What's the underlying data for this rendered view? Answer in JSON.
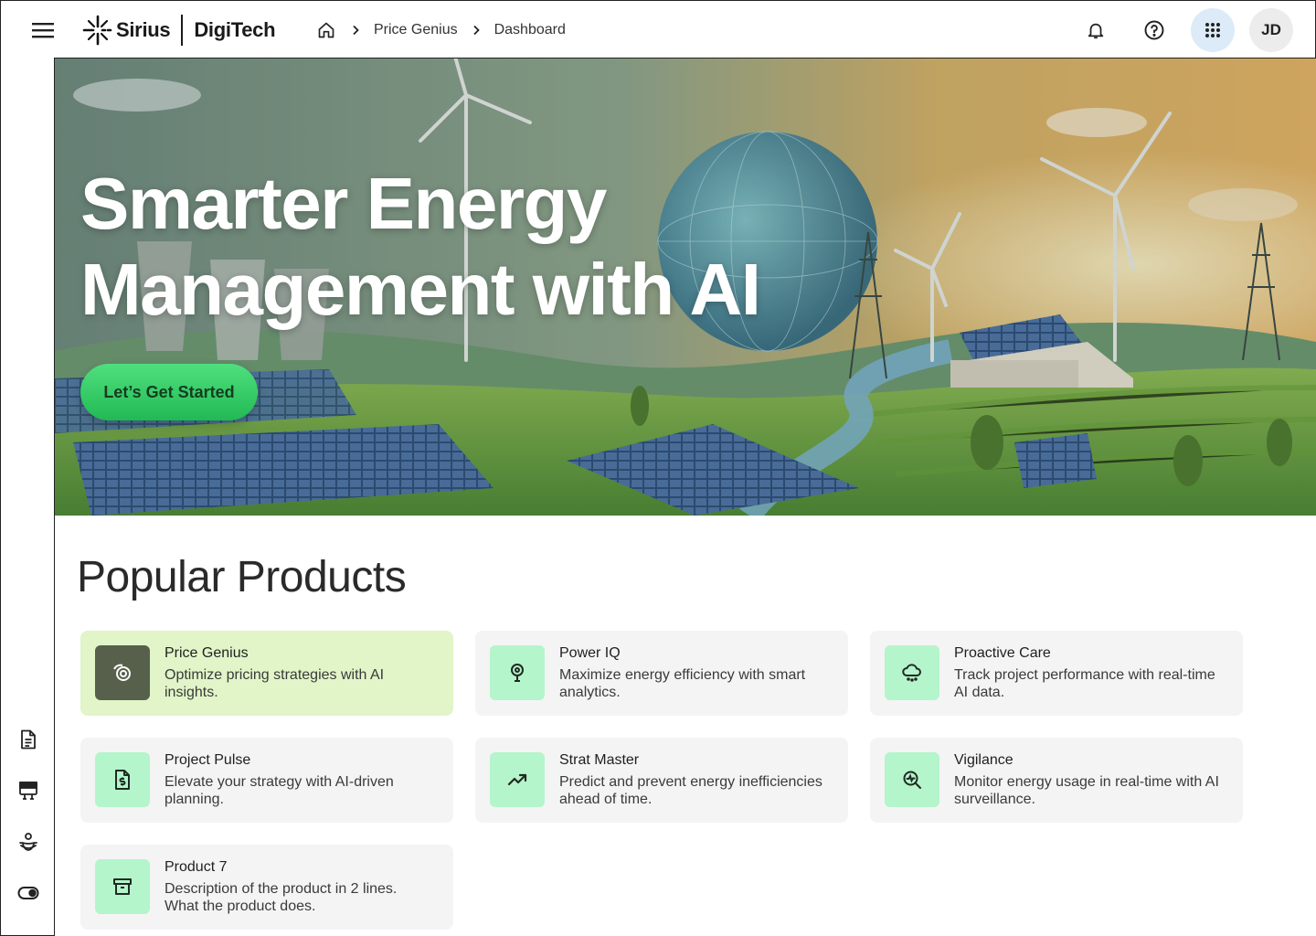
{
  "header": {
    "menu_icon": "hamburger-menu-icon",
    "logo": {
      "left": "Sirius",
      "right": "DigiTech"
    },
    "breadcrumb": {
      "home_icon": "home-icon",
      "items": [
        "Price Genius",
        "Dashboard"
      ]
    },
    "actions": {
      "notifications_icon": "bell-icon",
      "help_icon": "help-circle-icon",
      "apps_icon": "grid-apps-icon"
    },
    "user_initials": "JD"
  },
  "sidebar": {
    "items": [
      {
        "icon": "document-icon"
      },
      {
        "icon": "billboard-icon"
      },
      {
        "icon": "hand-coin-icon"
      },
      {
        "icon": "toggle-icon"
      }
    ]
  },
  "hero": {
    "title": "Smarter Energy Management with AI",
    "cta_label": "Let’s Get Started"
  },
  "products": {
    "title": "Popular Products",
    "items": [
      {
        "title": "Price Genius",
        "description": "Optimize pricing strategies with AI insights.",
        "icon": "target-swirl-icon",
        "active": true
      },
      {
        "title": "Power IQ",
        "description": "Maximize energy efficiency with smart analytics.",
        "icon": "lightbulb-icon",
        "active": false
      },
      {
        "title": "Proactive Care",
        "description": "Track project performance with real-time AI data.",
        "icon": "cloud-snow-icon",
        "active": false
      },
      {
        "title": "Project Pulse",
        "description": "Elevate your strategy with AI-driven planning.",
        "icon": "dollar-document-icon",
        "active": false
      },
      {
        "title": "Strat Master",
        "description": "Predict and prevent energy inefficiencies ahead of time.",
        "icon": "trending-up-icon",
        "active": false
      },
      {
        "title": "Vigilance",
        "description": "Monitor energy usage in real-time with AI surveillance.",
        "icon": "search-chart-icon",
        "active": false
      },
      {
        "title": "Product 7",
        "description": "Description of the product in 2 lines. What the product does.",
        "icon": "archive-box-icon",
        "active": false
      }
    ]
  },
  "colors": {
    "accent_green": "#22b955",
    "active_card": "#e1f5c8",
    "icon_tile": "#b4f5cb",
    "apps_button": "#dcebf7"
  }
}
